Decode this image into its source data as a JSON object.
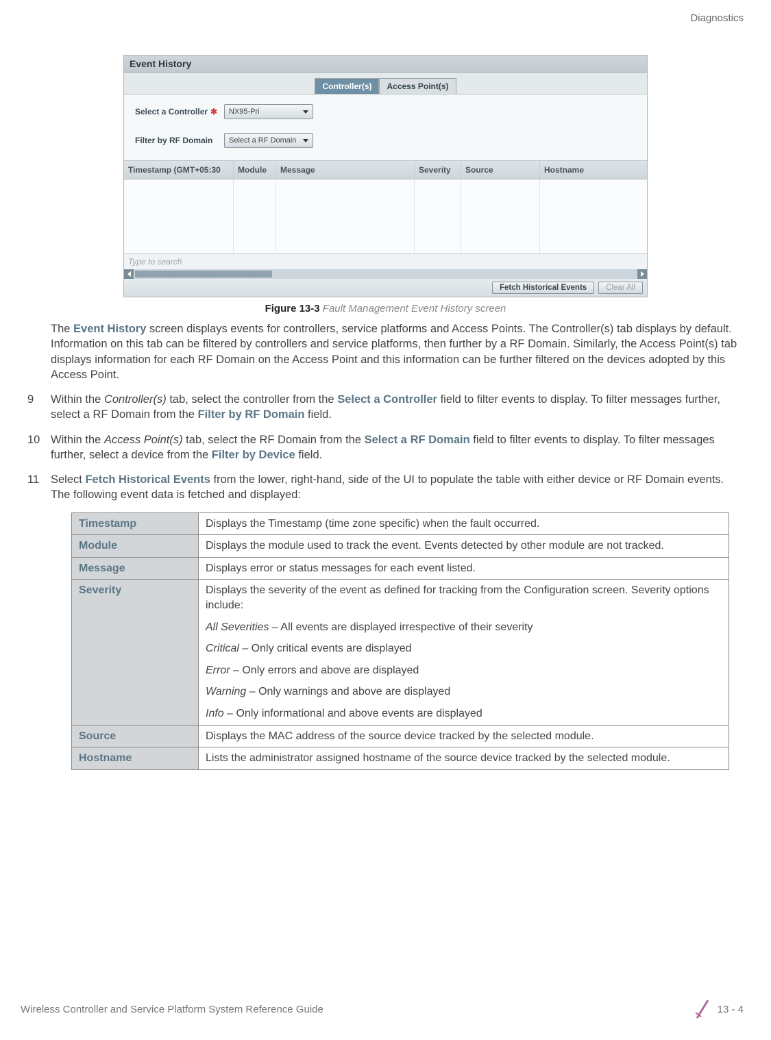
{
  "header": {
    "section": "Diagnostics"
  },
  "screenshot": {
    "title": "Event History",
    "tabs": {
      "controllers": "Controller(s)",
      "aps": "Access Point(s)"
    },
    "filters": {
      "select_controller_label": "Select a Controller",
      "select_controller_value": "NX95-Pri",
      "filter_rf_label": "Filter by RF Domain",
      "filter_rf_value": "Select a RF Domain"
    },
    "columns": {
      "timestamp": "Timestamp (GMT+05:30",
      "module": "Module",
      "message": "Message",
      "severity": "Severity",
      "source": "Source",
      "hostname": "Hostname"
    },
    "search_placeholder": "Type to search",
    "buttons": {
      "fetch": "Fetch Historical Events",
      "clear": "Clear All"
    }
  },
  "figure": {
    "label": "Figure 13-3",
    "caption": "Fault Management Event History screen"
  },
  "paragraphs": {
    "intro": {
      "pre": "The ",
      "accent": "Event History",
      "post": " screen displays events for controllers, service platforms and Access Points. The Controller(s) tab displays by default. Information on this tab can be filtered by controllers and service platforms, then further by a RF Domain. Similarly, the Access Point(s) tab displays information for each RF Domain on the Access Point and this information can be further filtered on the devices adopted by this Access Point."
    },
    "step9": {
      "num": "9",
      "t1": "Within the ",
      "i1": "Controller(s)",
      "t2": " tab, select the controller from the ",
      "a1": "Select a Controller",
      "t3": " field to filter events to display. To filter messages further, select a RF Domain from the ",
      "a2": "Filter by RF Domain",
      "t4": " field."
    },
    "step10": {
      "num": "10",
      "t1": "Within the ",
      "i1": "Access Point(s)",
      "t2": " tab, select the RF Domain from the ",
      "a1": "Select a RF Domain",
      "t3": " field to filter events to display. To filter messages further, select a device from the ",
      "a2": "Filter by Device",
      "t4": " field."
    },
    "step11": {
      "num": "11",
      "t1": "Select ",
      "a1": "Fetch Historical Events",
      "t2": " from the lower, right-hand, side of the UI to populate the table with either device or RF Domain events. The following event data is fetched and displayed:"
    }
  },
  "def_table": {
    "timestamp": {
      "key": "Timestamp",
      "val": "Displays the Timestamp (time zone specific) when the fault occurred."
    },
    "module": {
      "key": "Module",
      "val": "Displays the module used to track the event. Events detected by other module are not tracked."
    },
    "message": {
      "key": "Message",
      "val": "Displays error or status messages for each event listed."
    },
    "severity": {
      "key": "Severity",
      "intro": "Displays the severity of the event as defined for tracking from the Configuration screen. Severity options include:",
      "opts": {
        "all": {
          "name": "All Severities",
          "desc": " – All events are displayed irrespective of their severity"
        },
        "crit": {
          "name": "Critical",
          "desc": " – Only critical events are displayed"
        },
        "err": {
          "name": "Error",
          "desc": " – Only errors and above are displayed"
        },
        "warn": {
          "name": "Warning",
          "desc": " – Only warnings and above are displayed"
        },
        "info": {
          "name": "Info",
          "desc": " – Only informational and above events are displayed"
        }
      }
    },
    "source": {
      "key": "Source",
      "val": "Displays the MAC address of the source device tracked by the selected module."
    },
    "hostname": {
      "key": "Hostname",
      "val": "Lists the administrator assigned hostname of the source device tracked by the selected module."
    }
  },
  "footer": {
    "guide": "Wireless Controller and Service Platform System Reference Guide",
    "page": "13 - 4"
  }
}
